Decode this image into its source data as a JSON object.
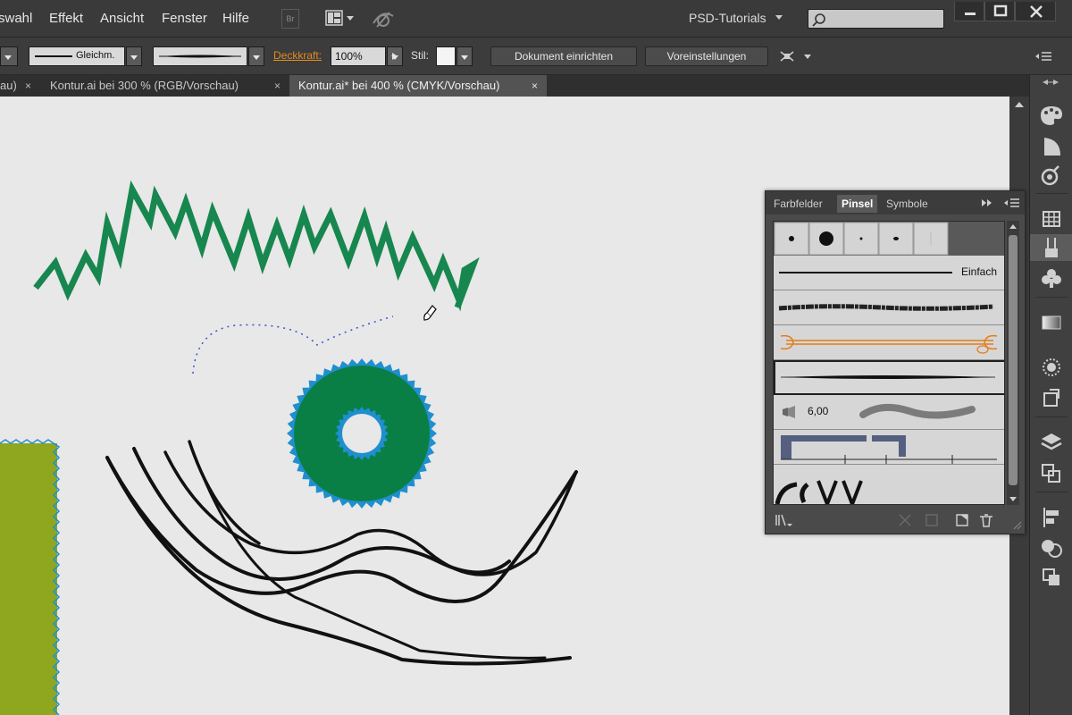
{
  "menubar": {
    "items": [
      "swahl",
      "Effekt",
      "Ansicht",
      "Fenster",
      "Hilfe"
    ],
    "bridge_label": "Br",
    "workspace": "PSD-Tutorials"
  },
  "controlbar": {
    "stroke_profile": "Gleichm.",
    "opacity_label": "Deckkraft:",
    "opacity_value": "100%",
    "style_label": "Stil:",
    "doc_setup_button": "Dokument einrichten",
    "preferences_button": "Voreinstellungen"
  },
  "tabs": [
    {
      "label": "Kontur.ai bei 300 % (RGB/Vorschau)",
      "active": false
    },
    {
      "label": "Kontur.ai* bei 400 % (CMYK/Vorschau)",
      "active": true
    }
  ],
  "tab_close_glyph": "×",
  "brushes_panel": {
    "tabs": [
      "Farbfelder",
      "Pinsel",
      "Symbole"
    ],
    "active_tab": "Pinsel",
    "basic_brush_label": "Einfach",
    "bristle_size": "6,00"
  },
  "colors": {
    "canvas": "#e8e8e8",
    "green_stroke": "#17874f",
    "ring_green": "#0a7f45",
    "ring_blue": "#1f8fd0",
    "olive_rect": "#8fa61f",
    "orange_accent": "#e27d18",
    "selection_blue": "#3a4fd6"
  },
  "icons": [
    "search-icon",
    "arrange-documents-icon",
    "gpu-preview-icon",
    "minimize-icon",
    "maximize-icon",
    "close-icon",
    "color-palette-icon",
    "color-guide-icon",
    "appearance-icon",
    "swatch-grid-icon",
    "brush-icon",
    "club-symbol-icon",
    "gradient-icon",
    "transparency-icon",
    "layers-icon",
    "artboards-icon",
    "align-icon",
    "pathfinder-icon",
    "transform-icon",
    "brush-library-icon",
    "delete-icon",
    "new-brush-icon",
    "brush-options-icon"
  ]
}
